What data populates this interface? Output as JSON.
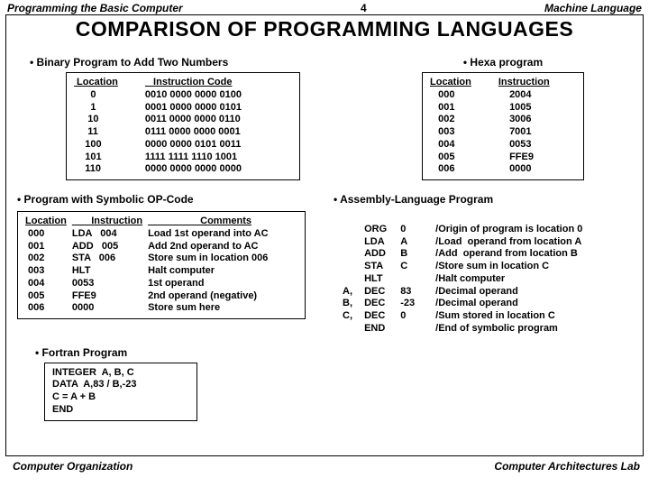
{
  "header": {
    "left": "Programming the Basic Computer",
    "page": "4",
    "right": "Machine Language"
  },
  "title": "COMPARISON  OF  PROGRAMMING LANGUAGES",
  "binary": {
    "title": "Binary Program to Add Two Numbers",
    "h_loc": "Location",
    "h_inst": "Instruction Code",
    "rows": [
      {
        "loc": "0",
        "inst": "0010 0000 0000 0100"
      },
      {
        "loc": "1",
        "inst": "0001 0000 0000 0101"
      },
      {
        "loc": "10",
        "inst": "0011 0000 0000 0110"
      },
      {
        "loc": "11",
        "inst": "0111 0000 0000 0001"
      },
      {
        "loc": "100",
        "inst": "0000 0000 0101 0011"
      },
      {
        "loc": "101",
        "inst": "1111 1111 1110 1001"
      },
      {
        "loc": "110",
        "inst": "0000 0000 0000 0000"
      }
    ]
  },
  "hexa": {
    "title": "Hexa program",
    "h_loc": "Location",
    "h_inst": "Instruction",
    "rows": [
      {
        "loc": "000",
        "inst": "2004"
      },
      {
        "loc": "001",
        "inst": "1005"
      },
      {
        "loc": "002",
        "inst": "3006"
      },
      {
        "loc": "003",
        "inst": "7001"
      },
      {
        "loc": "004",
        "inst": "0053"
      },
      {
        "loc": "005",
        "inst": "FFE9"
      },
      {
        "loc": "006",
        "inst": "0000"
      }
    ]
  },
  "symbolic": {
    "title": "Program with Symbolic OP-Code",
    "h_loc": "Location",
    "h_inst": "Instruction",
    "h_com": "Comments",
    "rows": [
      {
        "loc": "000",
        "op": "LDA",
        "arg": "004",
        "com": "Load 1st operand into AC"
      },
      {
        "loc": "001",
        "op": "ADD",
        "arg": "005",
        "com": "Add 2nd operand to AC"
      },
      {
        "loc": "002",
        "op": "STA",
        "arg": "006",
        "com": "Store sum in location 006"
      },
      {
        "loc": "003",
        "op": "HLT",
        "arg": "",
        "com": "Halt computer"
      },
      {
        "loc": "004",
        "op": "0053",
        "arg": "",
        "com": "1st operand"
      },
      {
        "loc": "005",
        "op": "FFE9",
        "arg": "",
        "com": "2nd operand (negative)"
      },
      {
        "loc": "006",
        "op": "0000",
        "arg": "",
        "com": "Store sum here"
      }
    ]
  },
  "asm": {
    "title": "Assembly-Language Program",
    "rows": [
      {
        "lbl": "",
        "op": "ORG",
        "arg": "0",
        "com": "/Origin of program is location 0"
      },
      {
        "lbl": "",
        "op": "LDA",
        "arg": "A",
        "com": "/Load  operand from location A"
      },
      {
        "lbl": "",
        "op": "ADD",
        "arg": "B",
        "com": "/Add  operand from location B"
      },
      {
        "lbl": "",
        "op": "STA",
        "arg": "C",
        "com": "/Store sum in location C"
      },
      {
        "lbl": "",
        "op": "HLT",
        "arg": "",
        "com": "/Halt computer"
      },
      {
        "lbl": "A,",
        "op": "DEC",
        "arg": "83",
        "com": "/Decimal operand"
      },
      {
        "lbl": "B,",
        "op": "DEC",
        "arg": "-23",
        "com": "/Decimal operand"
      },
      {
        "lbl": "C,",
        "op": "DEC",
        "arg": "0",
        "com": "/Sum stored in location C"
      },
      {
        "lbl": "",
        "op": "END",
        "arg": "",
        "com": "/End of symbolic program"
      }
    ]
  },
  "fortran": {
    "title": "Fortran Program",
    "lines": [
      "INTEGER  A, B, C",
      "DATA  A,83 / B,-23",
      "C = A + B",
      "END"
    ]
  },
  "footer": {
    "left": "Computer Organization",
    "right": "Computer Architectures Lab"
  }
}
